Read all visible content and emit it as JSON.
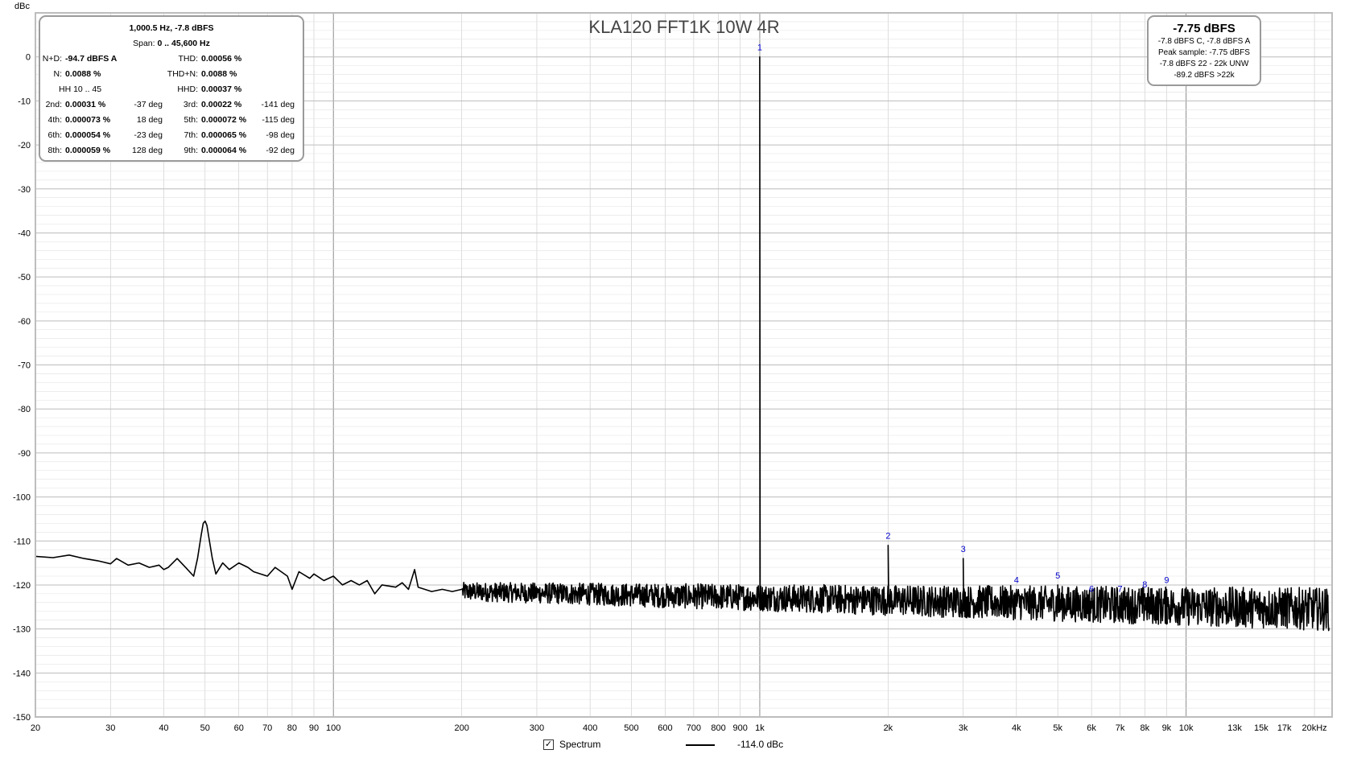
{
  "chart_data": {
    "type": "line",
    "title": "KLA120 FFT1K 10W 4R",
    "ylabel": "dBc",
    "xscale": "log",
    "xlim": [
      20,
      22000
    ],
    "ylim": [
      -150,
      10
    ],
    "grid": true,
    "x_ticks": [
      {
        "v": 20,
        "t": "20"
      },
      {
        "v": 30,
        "t": "30"
      },
      {
        "v": 40,
        "t": "40"
      },
      {
        "v": 50,
        "t": "50"
      },
      {
        "v": 60,
        "t": "60"
      },
      {
        "v": 70,
        "t": "70"
      },
      {
        "v": 80,
        "t": "80"
      },
      {
        "v": 90,
        "t": "90"
      },
      {
        "v": 100,
        "t": "100"
      },
      {
        "v": 200,
        "t": "200"
      },
      {
        "v": 300,
        "t": "300"
      },
      {
        "v": 400,
        "t": "400"
      },
      {
        "v": 500,
        "t": "500"
      },
      {
        "v": 600,
        "t": "600"
      },
      {
        "v": 700,
        "t": "700"
      },
      {
        "v": 800,
        "t": "800"
      },
      {
        "v": 900,
        "t": "900"
      },
      {
        "v": 1000,
        "t": "1k"
      },
      {
        "v": 2000,
        "t": "2k"
      },
      {
        "v": 3000,
        "t": "3k"
      },
      {
        "v": 4000,
        "t": "4k"
      },
      {
        "v": 5000,
        "t": "5k"
      },
      {
        "v": 6000,
        "t": "6k"
      },
      {
        "v": 7000,
        "t": "7k"
      },
      {
        "v": 8000,
        "t": "8k"
      },
      {
        "v": 9000,
        "t": "9k"
      },
      {
        "v": 10000,
        "t": "10k"
      },
      {
        "v": 13000,
        "t": "13k"
      },
      {
        "v": 15000,
        "t": "15k"
      },
      {
        "v": 17000,
        "t": "17k"
      },
      {
        "v": 20000,
        "t": "20kHz"
      }
    ],
    "y_ticks": [
      0,
      -10,
      -20,
      -30,
      -40,
      -50,
      -60,
      -70,
      -80,
      -90,
      -100,
      -110,
      -120,
      -130,
      -140,
      -150
    ],
    "series": [
      {
        "name": "Spectrum",
        "color": "#000000",
        "points": [
          [
            20,
            -113.5
          ],
          [
            22,
            -113.8
          ],
          [
            24,
            -113.2
          ],
          [
            26,
            -114.0
          ],
          [
            28,
            -114.5
          ],
          [
            30,
            -115.2
          ],
          [
            31,
            -114.0
          ],
          [
            33,
            -115.5
          ],
          [
            35,
            -115.0
          ],
          [
            37,
            -116.0
          ],
          [
            39,
            -115.5
          ],
          [
            40,
            -116.5
          ],
          [
            41,
            -116.0
          ],
          [
            43,
            -114.0
          ],
          [
            45,
            -116.0
          ],
          [
            47,
            -118.0
          ],
          [
            48,
            -114.0
          ],
          [
            49,
            -108.5
          ],
          [
            49.5,
            -106.0
          ],
          [
            50,
            -105.5
          ],
          [
            50.5,
            -106.5
          ],
          [
            51,
            -109.0
          ],
          [
            52,
            -114.0
          ],
          [
            53,
            -117.5
          ],
          [
            55,
            -115.0
          ],
          [
            57,
            -116.5
          ],
          [
            60,
            -115.0
          ],
          [
            63,
            -116.0
          ],
          [
            65,
            -117.0
          ],
          [
            70,
            -118.0
          ],
          [
            73,
            -116.0
          ],
          [
            78,
            -118.0
          ],
          [
            80,
            -121.0
          ],
          [
            83,
            -117.0
          ],
          [
            88,
            -118.5
          ],
          [
            90,
            -117.5
          ],
          [
            95,
            -119.0
          ],
          [
            100,
            -118.0
          ],
          [
            105,
            -120.0
          ],
          [
            110,
            -119.0
          ],
          [
            115,
            -120.0
          ],
          [
            120,
            -119.0
          ],
          [
            125,
            -122.0
          ],
          [
            130,
            -120.0
          ],
          [
            140,
            -120.5
          ],
          [
            145,
            -119.5
          ],
          [
            150,
            -121.0
          ],
          [
            155,
            -116.5
          ],
          [
            158,
            -120.5
          ],
          [
            170,
            -121.5
          ],
          [
            180,
            -121.0
          ],
          [
            190,
            -121.5
          ],
          [
            200,
            -121.0
          ]
        ],
        "noise_floor_from_200hz": {
          "start": -121.5,
          "end": -125.5,
          "jitter_db": 3.5
        },
        "peaks": [
          {
            "f": 1000,
            "db": 0
          },
          {
            "f": 2000,
            "db": -111
          },
          {
            "f": 3000,
            "db": -114
          },
          {
            "f": 4000,
            "db": -121
          },
          {
            "f": 5000,
            "db": -120
          },
          {
            "f": 6000,
            "db": -123
          },
          {
            "f": 7000,
            "db": -123
          },
          {
            "f": 8000,
            "db": -122
          },
          {
            "f": 9000,
            "db": -121
          }
        ]
      }
    ],
    "annotations": [
      {
        "label": "1",
        "f": 1000,
        "db": 0
      },
      {
        "label": "2",
        "f": 2000,
        "db": -111
      },
      {
        "label": "3",
        "f": 3000,
        "db": -114
      },
      {
        "label": "4",
        "f": 4000,
        "db": -121
      },
      {
        "label": "5",
        "f": 5000,
        "db": -120
      },
      {
        "label": "6",
        "f": 6000,
        "db": -123
      },
      {
        "label": "7",
        "f": 7000,
        "db": -123
      },
      {
        "label": "8",
        "f": 8000,
        "db": -122
      },
      {
        "label": "9",
        "f": 9000,
        "db": -121
      }
    ],
    "annotation_color": "#0000cc",
    "grid_color": "#c8c8c8",
    "legend": {
      "entry": "Spectrum",
      "value": "-114.0 dBc",
      "position": "bottom-center",
      "checked": true
    }
  },
  "stats_panel": {
    "line1": "1,000.5 Hz, -7.8 dBFS",
    "line2_label": "Span:",
    "line2_value": "0 .. 45,600 Hz",
    "n_d_label": "N+D:",
    "n_d_value": "-94.7 dBFS A",
    "thd_label": "THD:",
    "thd_value": "0.00056 %",
    "n_label": "N:",
    "n_value": "0.0088 %",
    "thdn_label": "THD+N:",
    "thdn_value": "0.0088 %",
    "hh_label": "HH 10 .. 45",
    "hhd_label": "HHD:",
    "hhd_value": "0.00037 %",
    "harmonics": [
      {
        "l1": "2nd:",
        "v1": "0.00031 %",
        "p1": "-37 deg",
        "l2": "3rd:",
        "v2": "0.00022 %",
        "p2": "-141 deg"
      },
      {
        "l1": "4th:",
        "v1": "0.000073 %",
        "p1": "18 deg",
        "l2": "5th:",
        "v2": "0.000072 %",
        "p2": "-115 deg"
      },
      {
        "l1": "6th:",
        "v1": "0.000054 %",
        "p1": "-23 deg",
        "l2": "7th:",
        "v2": "0.000065 %",
        "p2": "-98 deg"
      },
      {
        "l1": "8th:",
        "v1": "0.000059 %",
        "p1": "128 deg",
        "l2": "9th:",
        "v2": "0.000064 %",
        "p2": "-92 deg"
      }
    ]
  },
  "level_panel": {
    "main": "-7.75 dBFS",
    "line1": "-7.8 dBFS C, -7.8 dBFS A",
    "line2": "Peak sample: -7.75 dBFS",
    "line3": "-7.8 dBFS 22 - 22k UNW",
    "line4": "-89.2 dBFS >22k"
  }
}
